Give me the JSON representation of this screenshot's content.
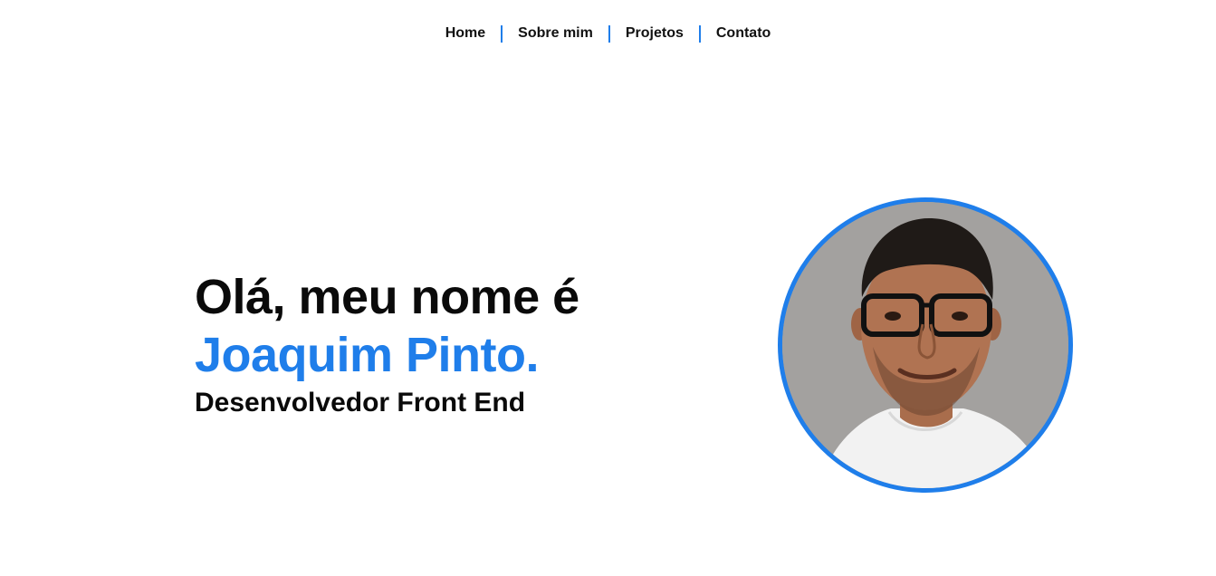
{
  "nav": {
    "items": [
      {
        "label": "Home"
      },
      {
        "label": "Sobre mim"
      },
      {
        "label": "Projetos"
      },
      {
        "label": "Contato"
      }
    ]
  },
  "hero": {
    "greeting": "Olá, meu nome é",
    "name": "Joaquim Pinto.",
    "role": "Desenvolvedor Front End"
  },
  "colors": {
    "accent": "#1f7eea",
    "text": "#0a0a0a",
    "photo_background": "#a3a19f"
  },
  "icons": {
    "avatar": "profile-photo"
  }
}
